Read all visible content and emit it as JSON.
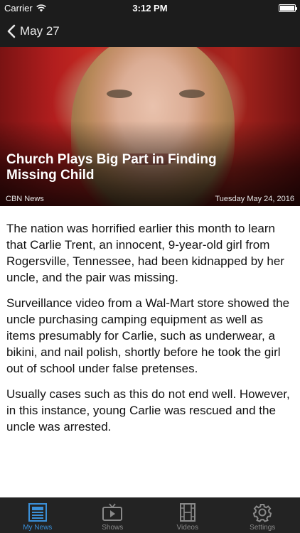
{
  "status_bar": {
    "carrier": "Carrier",
    "time": "3:12 PM"
  },
  "nav": {
    "back_label": "May 27"
  },
  "hero": {
    "headline": "Church Plays Big Part in Finding Missing Child",
    "source": "CBN News",
    "date": "Tuesday May 24, 2016"
  },
  "article": {
    "paragraphs": [
      "The nation was horrified earlier this month to learn that Carlie Trent, an innocent, 9-year-old girl from Rogersville, Tennessee, had been kidnapped by her uncle, and the pair was missing.",
      "Surveillance video from a Wal-Mart store showed the uncle purchasing camping equipment as well as items presumably for Carlie, such as underwear, a bikini, and nail polish, shortly before he took the girl out of school under false pretenses.",
      "Usually cases such as this do not end well. However, in this instance, young Carlie was rescued and the uncle was arrested."
    ]
  },
  "tabs": [
    {
      "label": "My News",
      "icon": "newspaper-icon",
      "active": true
    },
    {
      "label": "Shows",
      "icon": "tv-icon",
      "active": false
    },
    {
      "label": "Videos",
      "icon": "film-icon",
      "active": false
    },
    {
      "label": "Settings",
      "icon": "gear-icon",
      "active": false
    }
  ],
  "colors": {
    "active_tab": "#3a8fd8",
    "bar_background": "#1c1c1c"
  }
}
